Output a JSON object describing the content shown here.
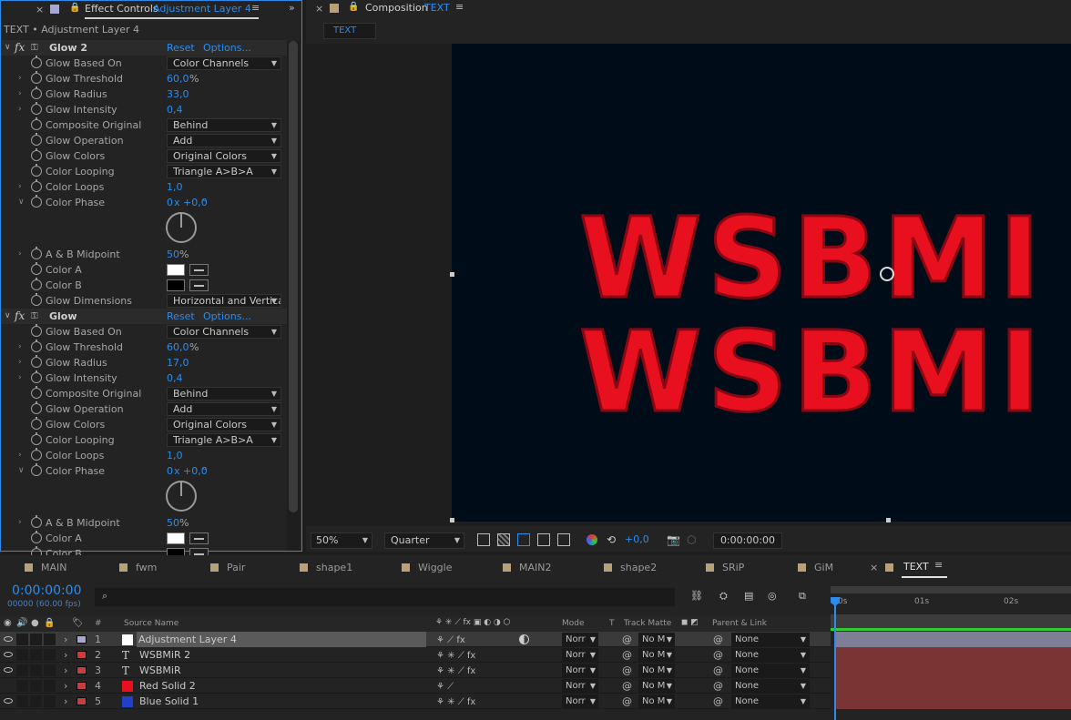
{
  "effect_controls": {
    "tab_label": "Effect Controls",
    "tab_layer": "Adjustment Layer 4",
    "breadcrumb": "TEXT • Adjustment Layer 4",
    "effects": [
      {
        "name": "Glow 2",
        "reset": "Reset",
        "options": "Options...",
        "props": [
          {
            "label": "Glow Based On",
            "type": "dropdown",
            "value": "Color Channels"
          },
          {
            "label": "Glow Threshold",
            "type": "value",
            "value": "60,0",
            "unit": "%"
          },
          {
            "label": "Glow Radius",
            "type": "value",
            "value": "33,0"
          },
          {
            "label": "Glow Intensity",
            "type": "value",
            "value": "0,4"
          },
          {
            "label": "Composite Original",
            "type": "dropdown",
            "value": "Behind"
          },
          {
            "label": "Glow Operation",
            "type": "dropdown",
            "value": "Add"
          },
          {
            "label": "Glow Colors",
            "type": "dropdown",
            "value": "Original Colors"
          },
          {
            "label": "Color Looping",
            "type": "dropdown",
            "value": "Triangle A>B>A"
          },
          {
            "label": "Color Loops",
            "type": "value",
            "value": "1,0"
          },
          {
            "label": "Color Phase",
            "type": "value",
            "value": "0",
            "extra": "x +0,0",
            "deg": "°"
          },
          {
            "label": "A & B Midpoint",
            "type": "value",
            "value": "50",
            "unit": "%"
          },
          {
            "label": "Color A",
            "type": "color",
            "color": "#ffffff"
          },
          {
            "label": "Color B",
            "type": "color",
            "color": "#000000"
          },
          {
            "label": "Glow Dimensions",
            "type": "dropdown",
            "value": "Horizontal and Vertical"
          }
        ]
      },
      {
        "name": "Glow",
        "reset": "Reset",
        "options": "Options...",
        "props": [
          {
            "label": "Glow Based On",
            "type": "dropdown",
            "value": "Color Channels"
          },
          {
            "label": "Glow Threshold",
            "type": "value",
            "value": "60,0",
            "unit": "%"
          },
          {
            "label": "Glow Radius",
            "type": "value",
            "value": "17,0"
          },
          {
            "label": "Glow Intensity",
            "type": "value",
            "value": "0,4"
          },
          {
            "label": "Composite Original",
            "type": "dropdown",
            "value": "Behind"
          },
          {
            "label": "Glow Operation",
            "type": "dropdown",
            "value": "Add"
          },
          {
            "label": "Glow Colors",
            "type": "dropdown",
            "value": "Original Colors"
          },
          {
            "label": "Color Looping",
            "type": "dropdown",
            "value": "Triangle A>B>A"
          },
          {
            "label": "Color Loops",
            "type": "value",
            "value": "1,0"
          },
          {
            "label": "Color Phase",
            "type": "value",
            "value": "0",
            "extra": "x +0,0",
            "deg": "°"
          },
          {
            "label": "A & B Midpoint",
            "type": "value",
            "value": "50",
            "unit": "%"
          },
          {
            "label": "Color A",
            "type": "color",
            "color": "#ffffff"
          },
          {
            "label": "Color B",
            "type": "color",
            "color": "#000000"
          }
        ]
      }
    ]
  },
  "composition": {
    "tab_label": "Composition",
    "tab_name": "TEXT",
    "sub_tab": "TEXT",
    "canvas_text_line1": "WSBMI",
    "canvas_text_line2": "WSBMI",
    "canvas_bg": "#000d18",
    "text_color": "#e8101e",
    "zoom": "50%",
    "resolution": "Quarter",
    "exposure": "+0,0",
    "timecode": "0:00:00:00"
  },
  "timeline": {
    "tabs": [
      "MAIN",
      "fwm",
      "Pair",
      "shape1",
      "Wiggle",
      "MAIN2",
      "shape2",
      "SRiP",
      "GiM"
    ],
    "active_tab": "TEXT",
    "timecode": "0:00:00:00",
    "frames": "00000 (60.00 fps)",
    "search_placeholder": "",
    "headers": {
      "hash": "#",
      "source": "Source Name",
      "mode": "Mode",
      "t": "T",
      "trackmatte": "Track Matte",
      "parent": "Parent & Link"
    },
    "ruler": [
      "0s",
      "01s",
      "02s"
    ],
    "layers": [
      {
        "num": "1",
        "name": "Adjustment Layer 4",
        "src": "adjust",
        "label_color": "#a6a6d2",
        "mode": "Norr",
        "tm": "No M",
        "parent": "None",
        "bar": "#7e7e96",
        "selected": true
      },
      {
        "num": "2",
        "name": "WSBMiR 2",
        "src": "text",
        "label_color": "#c83c3c",
        "mode": "Norr",
        "tm": "No M",
        "parent": "None",
        "bar": "#7a3434"
      },
      {
        "num": "3",
        "name": "WSBMiR",
        "src": "text",
        "label_color": "#c83c3c",
        "mode": "Norr",
        "tm": "No M",
        "parent": "None",
        "bar": "#7a3434"
      },
      {
        "num": "4",
        "name": "Red Solid 2",
        "src": "red",
        "label_color": "#c83c3c",
        "mode": "Norr",
        "tm": "No M",
        "parent": "None",
        "bar": "#7a3434"
      },
      {
        "num": "5",
        "name": "Blue Solid 1",
        "src": "blue",
        "label_color": "#c83c3c",
        "mode": "Norr",
        "tm": "No M",
        "parent": "None",
        "bar": "#7a3434"
      }
    ]
  }
}
